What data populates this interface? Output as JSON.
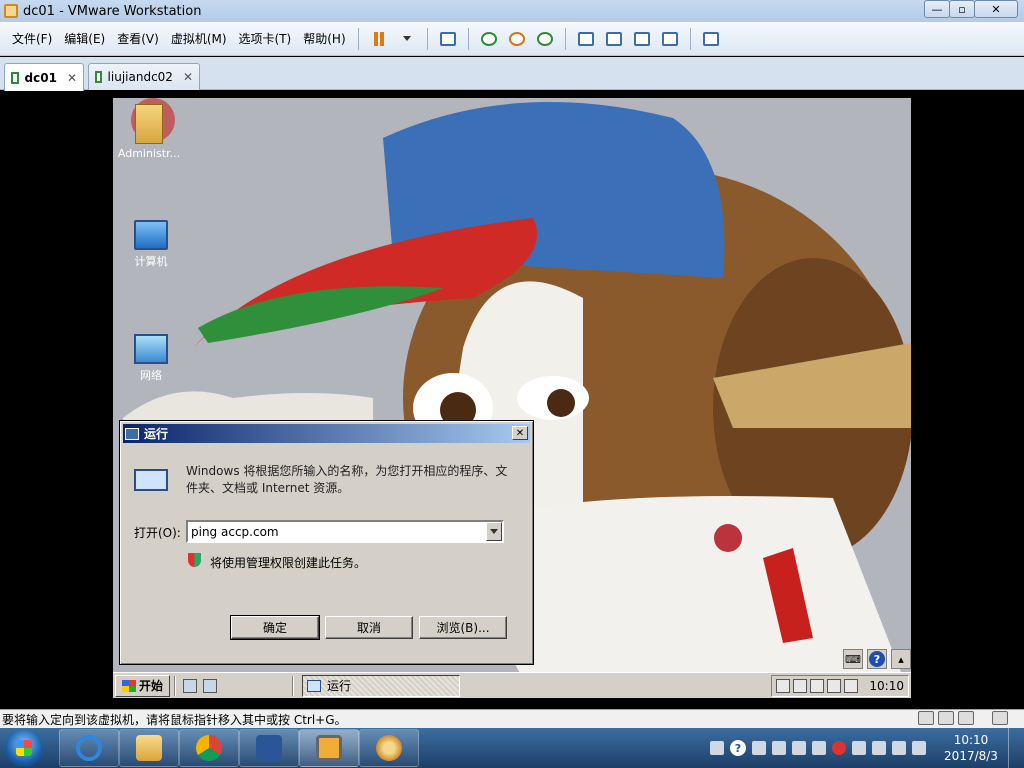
{
  "host_window": {
    "title": "dc01 - VMware Workstation",
    "controls": {
      "minimize": "—",
      "maximize": "▫",
      "close": "✕"
    }
  },
  "menubar": {
    "items": [
      "文件(F)",
      "编辑(E)",
      "查看(V)",
      "虚拟机(M)",
      "选项卡(T)",
      "帮助(H)"
    ]
  },
  "tabs": [
    {
      "label": "dc01",
      "active": true
    },
    {
      "label": "liujiandc02",
      "active": false
    }
  ],
  "guest": {
    "desktop_icons": [
      {
        "label": "Administr...",
        "icon": "folder-icon"
      },
      {
        "label": "计算机",
        "icon": "computer-icon"
      },
      {
        "label": "网络",
        "icon": "network-icon"
      }
    ],
    "run_dialog": {
      "title": "运行",
      "description": "Windows 将根据您所输入的名称，为您打开相应的程序、文件夹、文档或 Internet 资源。",
      "open_label": "打开(O):",
      "open_value": "ping accp.com",
      "admin_note": "将使用管理权限创建此任务。",
      "ok": "确定",
      "cancel": "取消",
      "browse": "浏览(B)..."
    },
    "taskbar": {
      "start_label": "开始",
      "running_task": "运行",
      "clock": "10:10"
    }
  },
  "statusbar": {
    "message": "要将输入定向到该虚拟机，请将鼠标指针移入其中或按 Ctrl+G。"
  },
  "host_taskbar": {
    "time": "10:10",
    "date": "2017/8/3",
    "pinned": [
      "internet-explorer-icon",
      "file-explorer-icon",
      "chrome-icon",
      "word-icon",
      "vmware-icon",
      "paint-icon"
    ]
  },
  "colors": {
    "guest_title_start": "#0a246a",
    "guest_title_end": "#a6caf0",
    "host_chrome": "#c6d9ef"
  }
}
